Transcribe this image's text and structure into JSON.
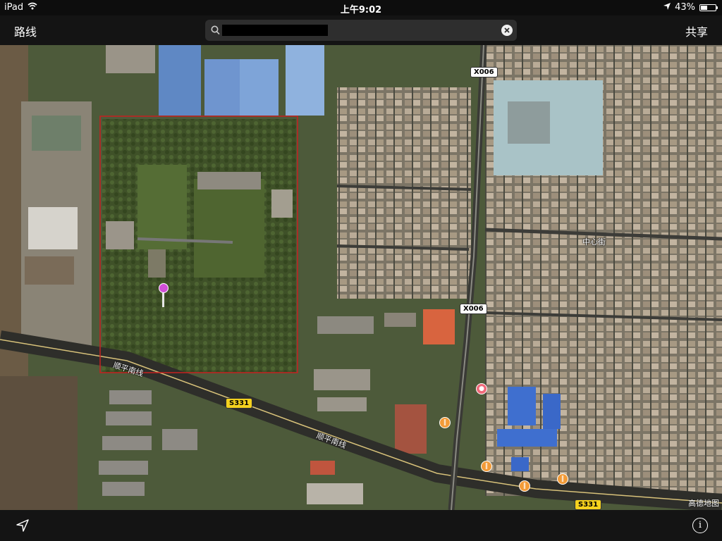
{
  "status_bar": {
    "device": "iPad",
    "time": "上午9:02",
    "battery": "43%",
    "battery_level": 0.43
  },
  "nav": {
    "left_label": "路线",
    "right_label": "共享",
    "search_value": ""
  },
  "map": {
    "road_labels": [
      "顺平南线",
      "顺平南线",
      "中心街"
    ],
    "shields": [
      "X006",
      "X006",
      "S331",
      "S331"
    ],
    "attribution": "高德地图"
  },
  "colors": {
    "pin": "#d04fd6",
    "selection_outline": "#c62020",
    "shield_provincial": "#f5d21e",
    "poi": "#f29b38"
  },
  "icons": {
    "search": "search-icon",
    "clear": "clear-icon",
    "location": "location-arrow-icon",
    "info": "info-icon",
    "pin": "map-pin-icon"
  }
}
